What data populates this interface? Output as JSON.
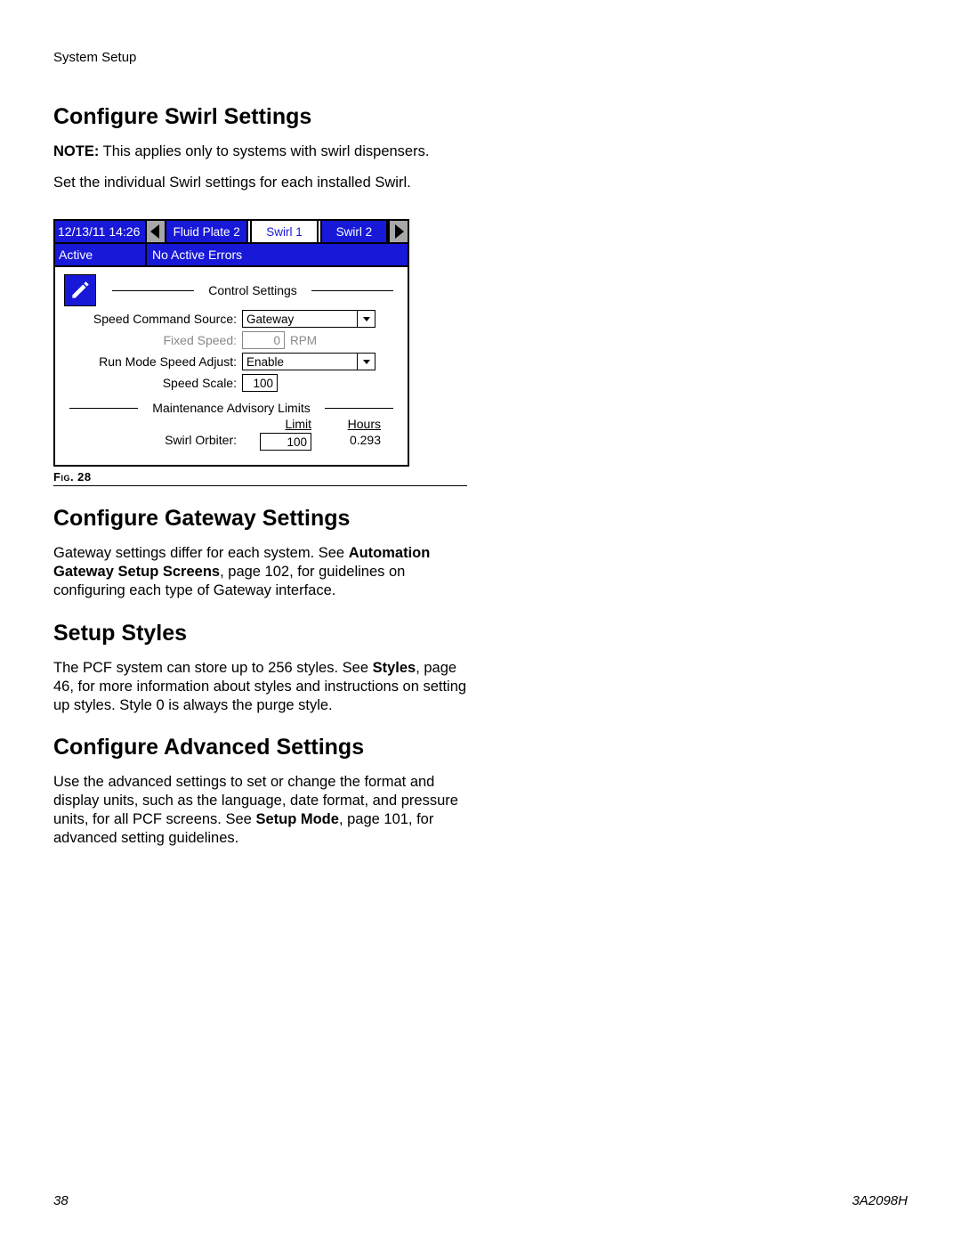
{
  "header": "System Setup",
  "sections": {
    "swirl": {
      "title": "Configure Swirl Settings",
      "note_label": "NOTE:",
      "note_text": " This applies only to systems with swirl dispensers.",
      "para2": "Set the individual Swirl settings for each installed Swirl."
    },
    "gateway": {
      "title": "Configure Gateway Settings",
      "text_a": "Gateway settings differ for each system. See ",
      "bold_a": "Automation Gateway Setup Screens",
      "text_b": ", page 102, for guidelines on configuring each type of Gateway interface."
    },
    "styles": {
      "title": "Setup Styles",
      "text_a": "The PCF system can store up to 256 styles. See ",
      "bold_a": "Styles",
      "text_b": ", page 46, for more information about styles and instructions on setting up styles. Style 0 is always the purge style."
    },
    "advanced": {
      "title": "Configure Advanced Settings",
      "text_a": "Use the advanced settings to set or change the format and display units, such as the language, date format, and pressure units, for all PCF screens. See ",
      "bold_a": "Setup Mode",
      "text_b": ", page 101, for advanced setting guidelines."
    }
  },
  "panel": {
    "datetime": "12/13/11 14:26",
    "tab_prev": "Fluid Plate 2",
    "tab_active": "Swirl 1",
    "tab_next": "Swirl 2",
    "status_left": "Active",
    "status_right": "No Active Errors",
    "section1": "Control Settings",
    "speed_cmd_label": "Speed Command Source:",
    "speed_cmd_value": "Gateway",
    "fixed_speed_label": "Fixed Speed:",
    "fixed_speed_value": "0",
    "fixed_speed_unit": "RPM",
    "run_mode_label": "Run Mode Speed Adjust:",
    "run_mode_value": "Enable",
    "speed_scale_label": "Speed Scale:",
    "speed_scale_value": "100",
    "section2": "Maintenance Advisory Limits",
    "col_limit": "Limit",
    "col_hours": "Hours",
    "orbiter_label": "Swirl Orbiter:",
    "orbiter_limit": "100",
    "orbiter_hours": "0.293"
  },
  "figure_caption": "Fig. 28",
  "footer": {
    "page": "38",
    "doc": "3A2098H"
  },
  "arrows": {
    "left": "←",
    "right": "→",
    "down": "▼"
  }
}
